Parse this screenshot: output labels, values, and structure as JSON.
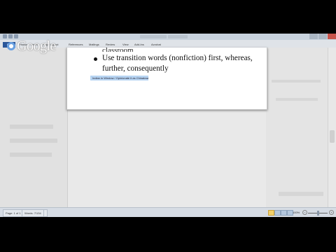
{
  "logo": {
    "text": "Google"
  },
  "ribbon": {
    "tabs": [
      "File",
      "Home",
      "Insert",
      "Page Layout",
      "References",
      "Mailings",
      "Review",
      "View",
      "Add-Ins",
      "Acrobat"
    ]
  },
  "document": {
    "cut_line": "classroom",
    "bullet_text": "Use transition words (nonfiction) first, whereas, further, consequently",
    "highlight_text": "Indian in Window / Opinionate it as Chinatown"
  },
  "status_bar": {
    "page": "Page: 1 of 1",
    "words": "Words: 7/134",
    "zoom_percent": "100%",
    "zoom_minus": "−",
    "zoom_plus": "+",
    "zoom_level": 1.0
  }
}
